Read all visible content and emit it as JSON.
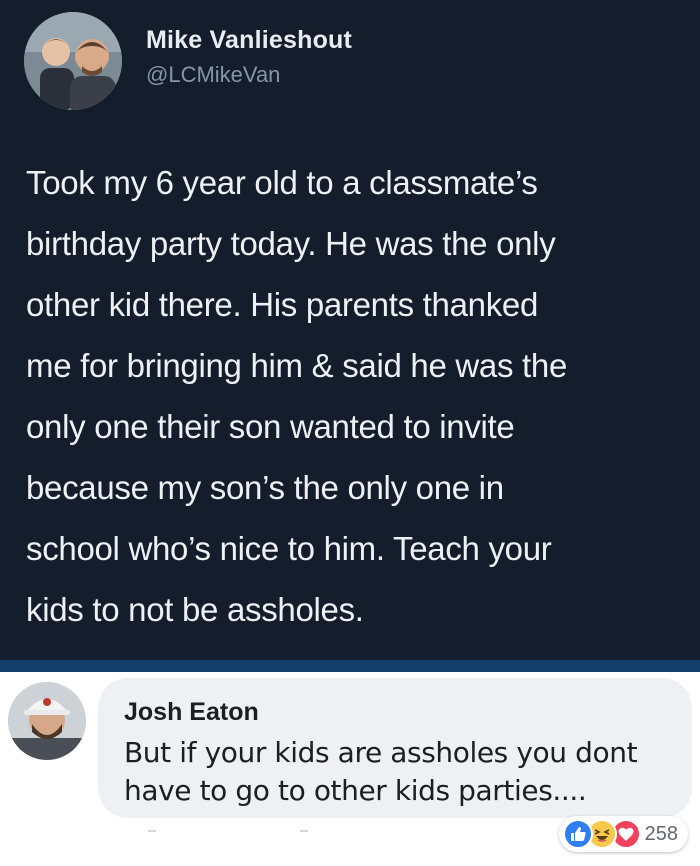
{
  "tweet": {
    "author_name": "Mike Vanlieshout",
    "author_handle": "@LCMikeVan",
    "text_lines": [
      "Took my 6 year old to a classmate’s",
      "birthday party today. He was the only",
      "other kid there. His parents thanked",
      "me for bringing him & said he was the",
      "only one their son wanted to invite",
      "because my son’s the only one in",
      "school who’s nice to him. Teach your",
      "kids to not be assholes."
    ]
  },
  "comment": {
    "author_name": "Josh Eaton",
    "text_lines": [
      "But if your kids are assholes you dont",
      "have to go to other kids parties...."
    ],
    "reactions": {
      "icons": [
        "like-reaction-icon",
        "haha-reaction-icon",
        "love-reaction-icon"
      ],
      "count": "258"
    }
  },
  "colors": {
    "tweet_background": "#141d2c",
    "accent_bar": "#123e6a",
    "bubble": "#eef0f3",
    "like": "#2f7ef3",
    "haha": "#f7c94b",
    "love": "#f0425c"
  }
}
